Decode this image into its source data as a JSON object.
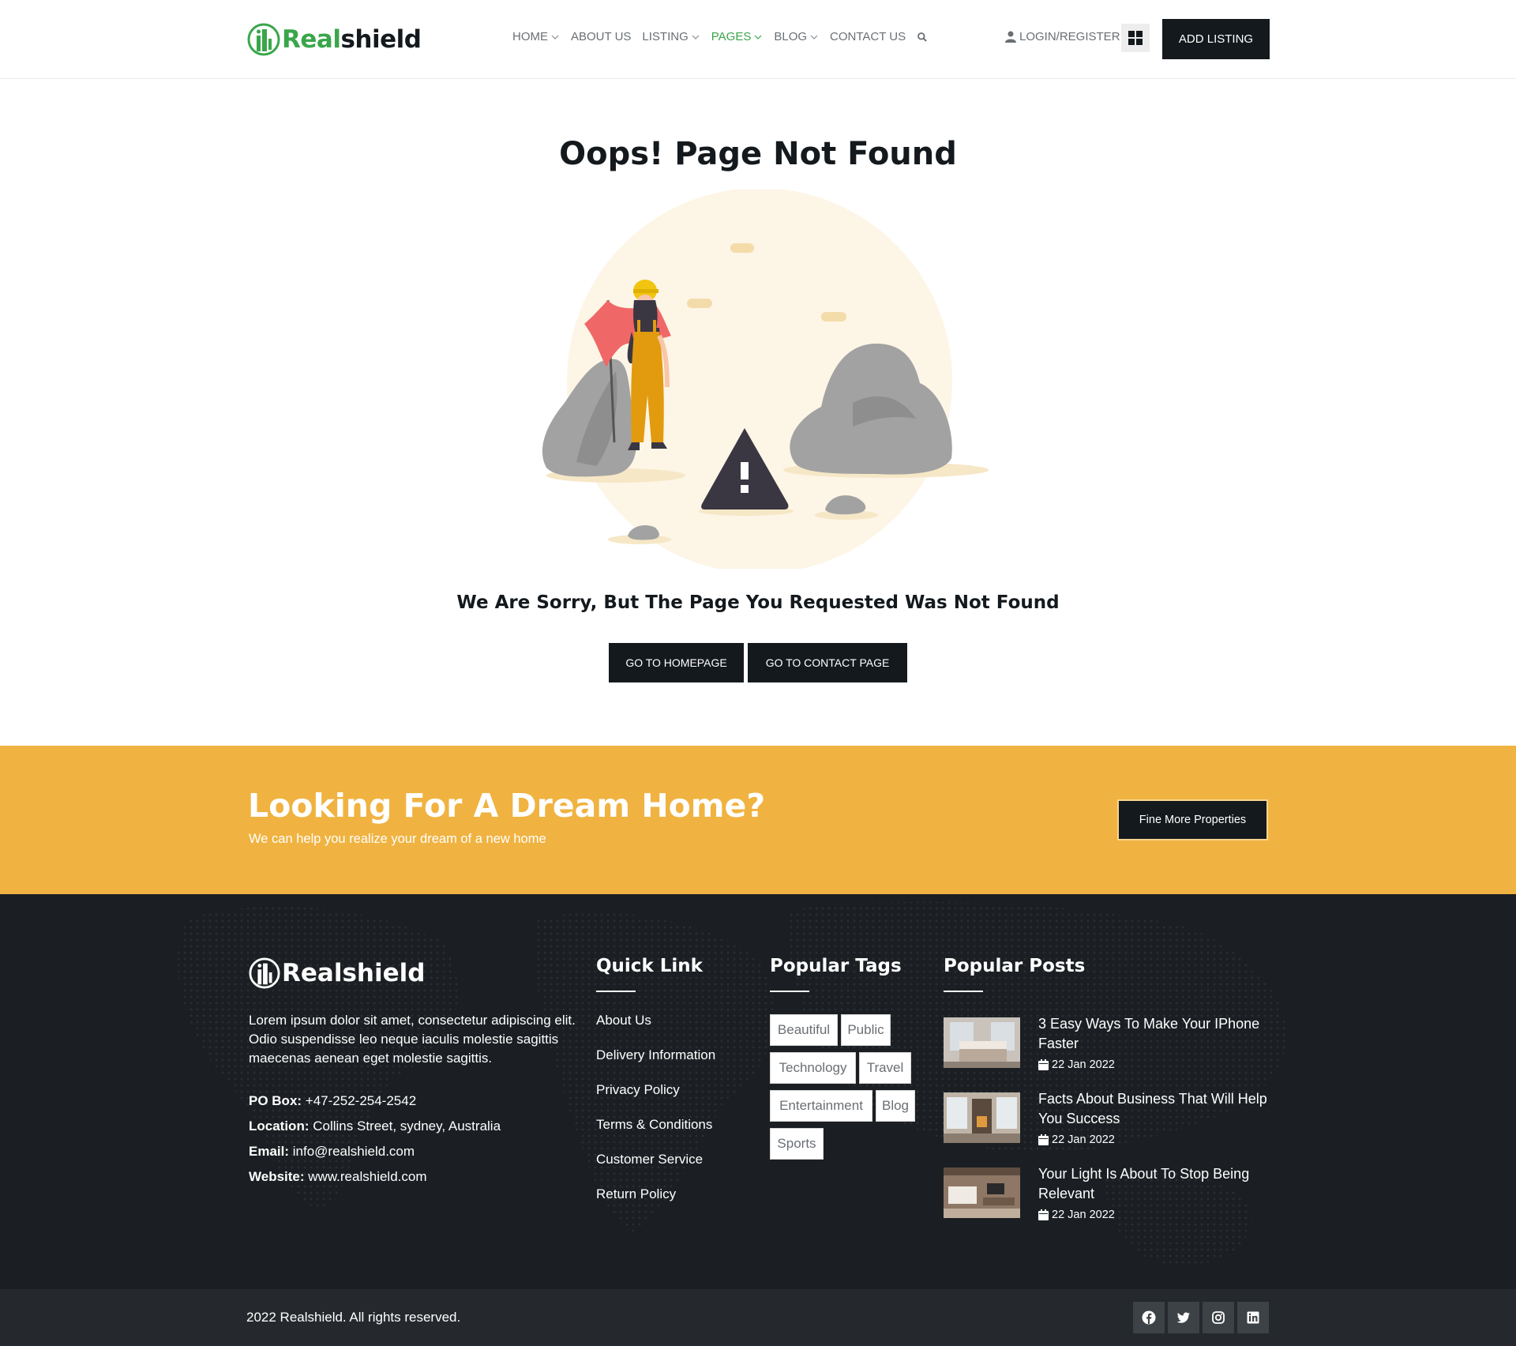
{
  "brand": {
    "name_green": "Real",
    "name_dark": "shield",
    "footer_name": "Realshield",
    "color_green": "#3aa64a",
    "color_dark": "#14191d"
  },
  "nav": {
    "items": [
      {
        "label": "HOME",
        "has_dropdown": true,
        "active": false
      },
      {
        "label": "ABOUT US",
        "has_dropdown": false,
        "active": false
      },
      {
        "label": "LISTING",
        "has_dropdown": true,
        "active": false
      },
      {
        "label": "PAGES",
        "has_dropdown": true,
        "active": true
      },
      {
        "label": "BLOG",
        "has_dropdown": true,
        "active": false
      },
      {
        "label": "CONTACT US",
        "has_dropdown": false,
        "active": false
      }
    ],
    "search_icon": "search-icon",
    "login_label": "LOGIN/REGISTER",
    "grid_icon": "grid-icon",
    "add_listing_label": "ADD LISTING"
  },
  "error_page": {
    "title": "Oops! Page Not Found",
    "message": "We Are Sorry, But The Page You Requested Was Not Found",
    "home_button": "GO TO HOMEPAGE",
    "contact_button": "GO TO CONTACT PAGE",
    "illustration_colors": {
      "circle": "#fdf5e6",
      "flag": "#f06767",
      "overalls": "#e29b0f",
      "rock": "#a2a2a2",
      "warning": "#3a3743"
    }
  },
  "cta": {
    "title": "Looking For A Dream Home?",
    "subtitle": "We can help you realize your dream of a new home",
    "button": "Fine More Properties",
    "background": "#f0b341"
  },
  "footer": {
    "about": "Lorem ipsum dolor sit amet, consectetur adipiscing elit. Odio suspendisse leo neque iaculis molestie sagittis maecenas aenean eget molestie sagittis.",
    "contact": [
      {
        "label": "PO Box:",
        "value": "+47-252-254-2542"
      },
      {
        "label": "Location:",
        "value": "Collins Street, sydney, Australia"
      },
      {
        "label": "Email:",
        "value": "info@realshield.com"
      },
      {
        "label": "Website:",
        "value": "www.realshield.com"
      }
    ],
    "quick_link_title": "Quick Link",
    "quick_links": [
      "About Us",
      "Delivery Information",
      "Privacy Policy",
      "Terms & Conditions",
      "Customer Service",
      "Return Policy"
    ],
    "tags_title": "Popular Tags",
    "tags": [
      "Beautiful",
      "Public",
      "Technology",
      "Travel",
      "Entertainment",
      "Blog",
      "Sports"
    ],
    "posts_title": "Popular Posts",
    "posts": [
      {
        "title": "3 Easy Ways To Make Your IPhone Faster",
        "date": "22 Jan 2022"
      },
      {
        "title": "Facts About Business That Will Help You Success",
        "date": "22 Jan 2022"
      },
      {
        "title": "Your Light Is About To Stop Being Relevant",
        "date": "22 Jan 2022"
      }
    ],
    "copyright": "2022 Realshield. All rights reserved.",
    "social_icons": [
      "facebook-icon",
      "twitter-icon",
      "instagram-icon",
      "linkedin-icon"
    ],
    "background": "#1b1f23"
  }
}
